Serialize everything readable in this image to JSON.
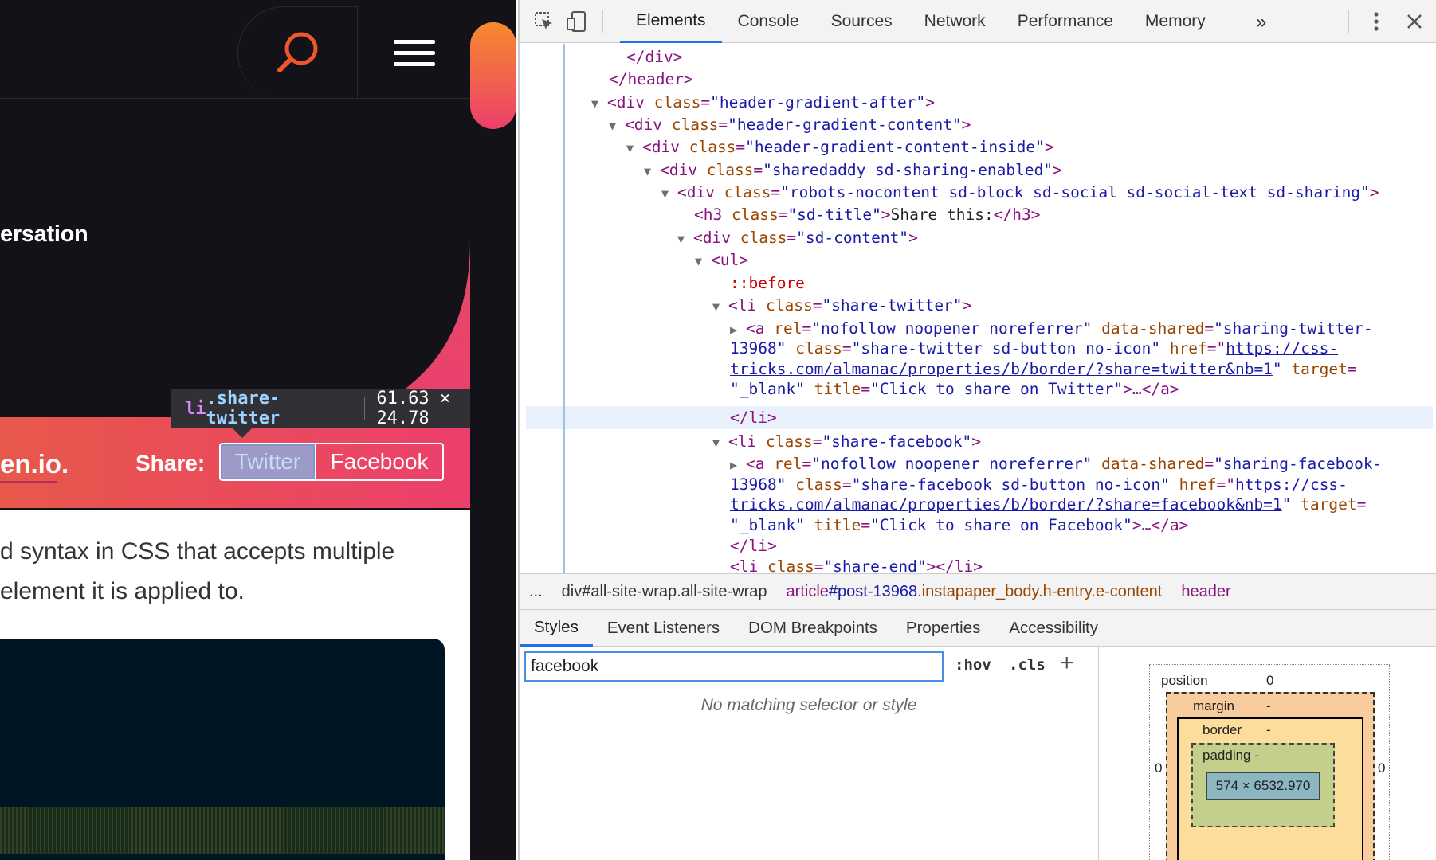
{
  "webpage": {
    "hero_text": "ersation",
    "share_brand": "en.io.",
    "share_label": "Share:",
    "twitter_button": "Twitter",
    "facebook_button": "Facebook",
    "article_line1": "d syntax in CSS that accepts multiple",
    "article_line2": "element it is applied to.",
    "tooltip": {
      "tag": "li",
      "class": ".share-twitter",
      "size": "61.63 × 24.78"
    },
    "colors": {
      "dark_bg": "#131218",
      "gradient_start": "#e8584a",
      "gradient_end": "#ec3f6c",
      "search_icon": "#f0562b"
    }
  },
  "devtools": {
    "tabs": [
      {
        "label": "Elements",
        "active": true
      },
      {
        "label": "Console"
      },
      {
        "label": "Sources"
      },
      {
        "label": "Network"
      },
      {
        "label": "Performance"
      },
      {
        "label": "Memory"
      }
    ],
    "more_tabs": "»",
    "dom": {
      "l01": "</div>",
      "l02": "</header>",
      "l03_tag": "<div",
      "l03_attr": "class",
      "l03_val": "\"header-gradient-after\"",
      "l04_val": "\"header-gradient-content\"",
      "l05_val": "\"header-gradient-content-inside\"",
      "l06_val": "\"sharedaddy sd-sharing-enabled\"",
      "l07_val": "\"robots-nocontent sd-block sd-social sd-social-text sd-sharing\"",
      "l08_tag": "<h3",
      "l08_val": "\"sd-title\"",
      "l08_text": "Share this:",
      "l08_close": "</h3>",
      "l09_val": "\"sd-content\"",
      "l10": "<ul>",
      "l11": "::before",
      "l12_tag": "<li",
      "l12_val": "\"share-twitter\"",
      "l13_tag": "<a",
      "l13_rel_attr": "rel",
      "l13_rel": "\"nofollow noopener noreferrer\"",
      "l13_ds_attr": "data-shared",
      "l13_ds": "\"sharing-twitter-",
      "l14_ds": "13968\"",
      "l14_class_attr": "class",
      "l14_class": "\"share-twitter sd-button no-icon\"",
      "l14_href_attr": "href",
      "l14_href": "https://css-",
      "l15_href": "tricks.com/almanac/properties/b/border/?share=twitter&nb=1",
      "l15_target_attr": "target",
      "l16_target": "\"_blank\"",
      "l16_title_attr": "title",
      "l16_title": "\"Click to share on Twitter\"",
      "l16_close": ">…</a>",
      "l17": "</li>",
      "l18_val": "\"share-facebook\"",
      "l19_ds": "\"sharing-facebook-",
      "l20_class": "\"share-facebook sd-button no-icon\"",
      "l21_href": "tricks.com/almanac/properties/b/border/?share=facebook&nb=1",
      "l22_title": "\"Click to share on Facebook\"",
      "l24_val": "\"share-end\"",
      "l24_close": "></li>"
    },
    "breadcrumbs": {
      "ellipsis": "...",
      "c1": "div#all-site-wrap.all-site-wrap",
      "c2_tag": "article",
      "c2_id": "#post-13968",
      "c2_class": ".instapaper_body.h-entry.e-content",
      "c3": "header"
    },
    "sub_tabs": [
      {
        "label": "Styles",
        "active": true
      },
      {
        "label": "Event Listeners"
      },
      {
        "label": "DOM Breakpoints"
      },
      {
        "label": "Properties"
      },
      {
        "label": "Accessibility"
      }
    ],
    "filter": {
      "value": "facebook",
      "hov": ":hov",
      "cls": ".cls",
      "plus": "+"
    },
    "no_match": "No matching selector or style",
    "box_model": {
      "position_label": "position",
      "position_value": "0",
      "margin_label": "margin",
      "margin_value": "-",
      "border_label": "border",
      "border_value": "-",
      "padding_label": "padding -",
      "content": "574 × 6532.970",
      "left_value": "0",
      "right_value": "0",
      "dash": "-"
    }
  }
}
